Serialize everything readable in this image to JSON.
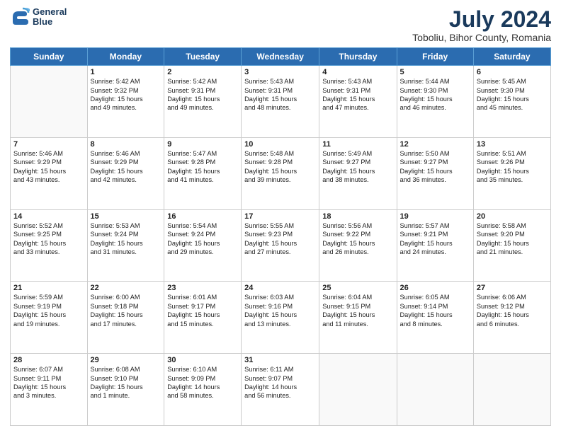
{
  "header": {
    "logo_line1": "General",
    "logo_line2": "Blue",
    "title": "July 2024",
    "subtitle": "Toboliu, Bihor County, Romania"
  },
  "days_of_week": [
    "Sunday",
    "Monday",
    "Tuesday",
    "Wednesday",
    "Thursday",
    "Friday",
    "Saturday"
  ],
  "weeks": [
    [
      {
        "day": "",
        "info": ""
      },
      {
        "day": "1",
        "info": "Sunrise: 5:42 AM\nSunset: 9:32 PM\nDaylight: 15 hours\nand 49 minutes."
      },
      {
        "day": "2",
        "info": "Sunrise: 5:42 AM\nSunset: 9:31 PM\nDaylight: 15 hours\nand 49 minutes."
      },
      {
        "day": "3",
        "info": "Sunrise: 5:43 AM\nSunset: 9:31 PM\nDaylight: 15 hours\nand 48 minutes."
      },
      {
        "day": "4",
        "info": "Sunrise: 5:43 AM\nSunset: 9:31 PM\nDaylight: 15 hours\nand 47 minutes."
      },
      {
        "day": "5",
        "info": "Sunrise: 5:44 AM\nSunset: 9:30 PM\nDaylight: 15 hours\nand 46 minutes."
      },
      {
        "day": "6",
        "info": "Sunrise: 5:45 AM\nSunset: 9:30 PM\nDaylight: 15 hours\nand 45 minutes."
      }
    ],
    [
      {
        "day": "7",
        "info": "Sunrise: 5:46 AM\nSunset: 9:29 PM\nDaylight: 15 hours\nand 43 minutes."
      },
      {
        "day": "8",
        "info": "Sunrise: 5:46 AM\nSunset: 9:29 PM\nDaylight: 15 hours\nand 42 minutes."
      },
      {
        "day": "9",
        "info": "Sunrise: 5:47 AM\nSunset: 9:28 PM\nDaylight: 15 hours\nand 41 minutes."
      },
      {
        "day": "10",
        "info": "Sunrise: 5:48 AM\nSunset: 9:28 PM\nDaylight: 15 hours\nand 39 minutes."
      },
      {
        "day": "11",
        "info": "Sunrise: 5:49 AM\nSunset: 9:27 PM\nDaylight: 15 hours\nand 38 minutes."
      },
      {
        "day": "12",
        "info": "Sunrise: 5:50 AM\nSunset: 9:27 PM\nDaylight: 15 hours\nand 36 minutes."
      },
      {
        "day": "13",
        "info": "Sunrise: 5:51 AM\nSunset: 9:26 PM\nDaylight: 15 hours\nand 35 minutes."
      }
    ],
    [
      {
        "day": "14",
        "info": "Sunrise: 5:52 AM\nSunset: 9:25 PM\nDaylight: 15 hours\nand 33 minutes."
      },
      {
        "day": "15",
        "info": "Sunrise: 5:53 AM\nSunset: 9:24 PM\nDaylight: 15 hours\nand 31 minutes."
      },
      {
        "day": "16",
        "info": "Sunrise: 5:54 AM\nSunset: 9:24 PM\nDaylight: 15 hours\nand 29 minutes."
      },
      {
        "day": "17",
        "info": "Sunrise: 5:55 AM\nSunset: 9:23 PM\nDaylight: 15 hours\nand 27 minutes."
      },
      {
        "day": "18",
        "info": "Sunrise: 5:56 AM\nSunset: 9:22 PM\nDaylight: 15 hours\nand 26 minutes."
      },
      {
        "day": "19",
        "info": "Sunrise: 5:57 AM\nSunset: 9:21 PM\nDaylight: 15 hours\nand 24 minutes."
      },
      {
        "day": "20",
        "info": "Sunrise: 5:58 AM\nSunset: 9:20 PM\nDaylight: 15 hours\nand 21 minutes."
      }
    ],
    [
      {
        "day": "21",
        "info": "Sunrise: 5:59 AM\nSunset: 9:19 PM\nDaylight: 15 hours\nand 19 minutes."
      },
      {
        "day": "22",
        "info": "Sunrise: 6:00 AM\nSunset: 9:18 PM\nDaylight: 15 hours\nand 17 minutes."
      },
      {
        "day": "23",
        "info": "Sunrise: 6:01 AM\nSunset: 9:17 PM\nDaylight: 15 hours\nand 15 minutes."
      },
      {
        "day": "24",
        "info": "Sunrise: 6:03 AM\nSunset: 9:16 PM\nDaylight: 15 hours\nand 13 minutes."
      },
      {
        "day": "25",
        "info": "Sunrise: 6:04 AM\nSunset: 9:15 PM\nDaylight: 15 hours\nand 11 minutes."
      },
      {
        "day": "26",
        "info": "Sunrise: 6:05 AM\nSunset: 9:14 PM\nDaylight: 15 hours\nand 8 minutes."
      },
      {
        "day": "27",
        "info": "Sunrise: 6:06 AM\nSunset: 9:12 PM\nDaylight: 15 hours\nand 6 minutes."
      }
    ],
    [
      {
        "day": "28",
        "info": "Sunrise: 6:07 AM\nSunset: 9:11 PM\nDaylight: 15 hours\nand 3 minutes."
      },
      {
        "day": "29",
        "info": "Sunrise: 6:08 AM\nSunset: 9:10 PM\nDaylight: 15 hours\nand 1 minute."
      },
      {
        "day": "30",
        "info": "Sunrise: 6:10 AM\nSunset: 9:09 PM\nDaylight: 14 hours\nand 58 minutes."
      },
      {
        "day": "31",
        "info": "Sunrise: 6:11 AM\nSunset: 9:07 PM\nDaylight: 14 hours\nand 56 minutes."
      },
      {
        "day": "",
        "info": ""
      },
      {
        "day": "",
        "info": ""
      },
      {
        "day": "",
        "info": ""
      }
    ]
  ]
}
